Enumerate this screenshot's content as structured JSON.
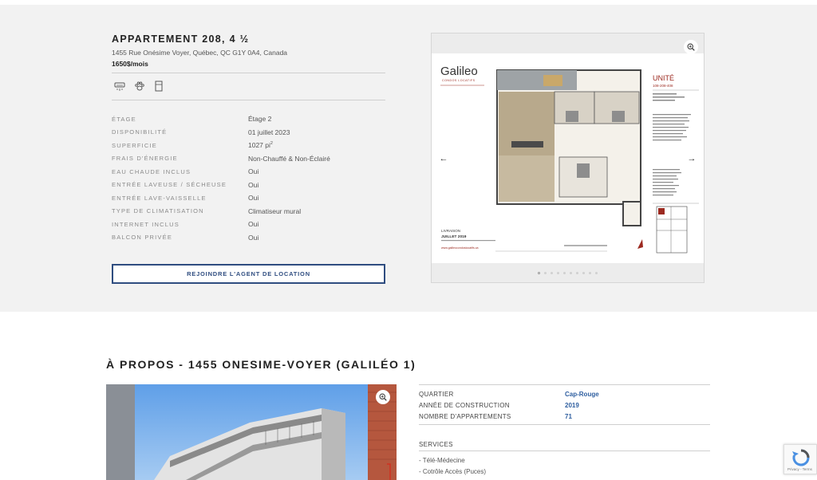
{
  "listing": {
    "title": "APPARTEMENT 208, 4 ½",
    "address": "1455 Rue Onésime Voyer, Québec, QC G1Y 0A4, Canada",
    "price": "1650$/mois"
  },
  "amenities": [
    {
      "icon": "air-conditioner-icon"
    },
    {
      "icon": "paw-icon"
    },
    {
      "icon": "refrigerator-icon"
    }
  ],
  "specs": [
    {
      "label": "ÉTAGE",
      "value": "Étage 2"
    },
    {
      "label": "DISPONIBILITÉ",
      "value": "01 juillet 2023"
    },
    {
      "label": "SUPERFICIE",
      "value": "1027 pi",
      "sup": "2"
    },
    {
      "label": "FRAIS D'ÉNERGIE",
      "value": "Non-Chauffé & Non-Éclairé"
    },
    {
      "label": "EAU CHAUDE INCLUS",
      "value": "Oui"
    },
    {
      "label": "ENTRÉE LAVEUSE / SÉCHEUSE",
      "value": "Oui"
    },
    {
      "label": "ENTRÉE LAVE-VAISSELLE",
      "value": "Oui"
    },
    {
      "label": "TYPE DE CLIMATISATION",
      "value": "Climatiseur mural"
    },
    {
      "label": "INTERNET INCLUS",
      "value": "Oui"
    },
    {
      "label": "BALCON PRIVÉE",
      "value": "Oui"
    }
  ],
  "agent_button": "REJOINDRE L'AGENT DE LOCATION",
  "floorplan": {
    "brand": "Galileo",
    "brand_sub": "CONDOS LOCATIFS",
    "unit_title": "UNITÉ",
    "unit_numbers": "108-208-408",
    "delivery_label": "LIVRAISON",
    "delivery_date": "JUILLET 2019",
    "website": "www.galileocondoslocatifs.ca"
  },
  "gallery": {
    "slide_count": 10,
    "active_index": 0
  },
  "about": {
    "title": "À PROPOS - 1455 ONESIME-VOYER (GALILÉO 1)",
    "details": [
      {
        "label": "QUARTIER",
        "value": "Cap-Rouge"
      },
      {
        "label": "ANNÉE DE CONSTRUCTION",
        "value": "2019"
      },
      {
        "label": "NOMBRE D'APPARTEMENTS",
        "value": "71"
      }
    ],
    "services_title": "SERVICES",
    "services": [
      "- Télé-Médecine",
      "- Cotrôle Accès (Puces)"
    ]
  },
  "recaptcha": {
    "text": "Privacy - Terms"
  },
  "colors": {
    "accent": "#2f4d80",
    "link": "#2f5fa0",
    "hero_bg": "#f2f2f2",
    "brand_red": "#9c2a20"
  }
}
